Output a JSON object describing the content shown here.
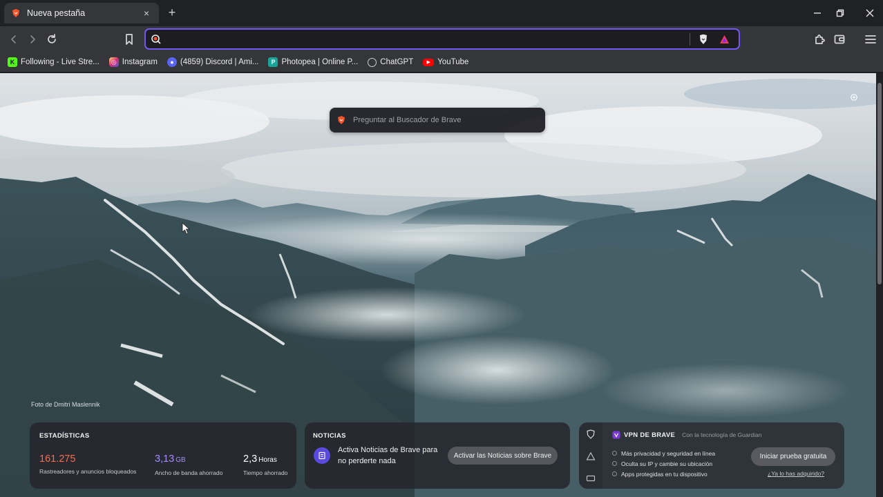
{
  "tab": {
    "title": "Nueva pestaña",
    "close": "×"
  },
  "tabbar": {
    "new_tab": "+"
  },
  "omnibox": {
    "value": "",
    "placeholder": ""
  },
  "bookmarks": [
    {
      "label": "Following - Live Stre...",
      "icon": "kick-icon",
      "color": "#53fc18"
    },
    {
      "label": "Instagram",
      "icon": "instagram-icon",
      "color": "#e1306c"
    },
    {
      "label": "(4859) Discord | Ami...",
      "icon": "discord-icon",
      "color": "#5865f2"
    },
    {
      "label": "Photopea | Online P...",
      "icon": "photopea-icon",
      "color": "#18a497"
    },
    {
      "label": "ChatGPT",
      "icon": "chatgpt-icon",
      "color": "#d0d0d0"
    },
    {
      "label": "YouTube",
      "icon": "youtube-icon",
      "color": "#ff0000"
    }
  ],
  "ntp": {
    "search_placeholder": "Preguntar al Buscador de Brave",
    "photo_credit": "Foto de Dmitri Maslennik",
    "stats": {
      "title": "ESTADÍSTICAS",
      "trackers_value": "161.275",
      "trackers_label": "Rastreadores y anuncios bloqueados",
      "bandwidth_value": "3,13",
      "bandwidth_unit": "GB",
      "bandwidth_label": "Ancho de banda ahorrado",
      "time_value": "2,3",
      "time_unit": "Horas",
      "time_label": "Tiempo ahorrado"
    },
    "news": {
      "title": "NOTICIAS",
      "text": "Activa Noticias de Brave para no perderte nada",
      "button": "Activar las Noticias sobre Brave"
    },
    "vpn": {
      "title": "VPN DE BRAVE",
      "powered_by": "Con la tecnología de Guardian",
      "features": [
        "Más privacidad y seguridad en línea",
        "Oculta su IP y cambie su ubicación",
        "Apps protegidas en tu dispositivo"
      ],
      "button": "Iniciar prueba gratuita",
      "link": "¿Ya lo has adquirido?"
    }
  },
  "colors": {
    "accent": "#7457f2",
    "trackers": "#ff6a4a",
    "bandwidth": "#a78bff",
    "time": "#ffffff"
  }
}
